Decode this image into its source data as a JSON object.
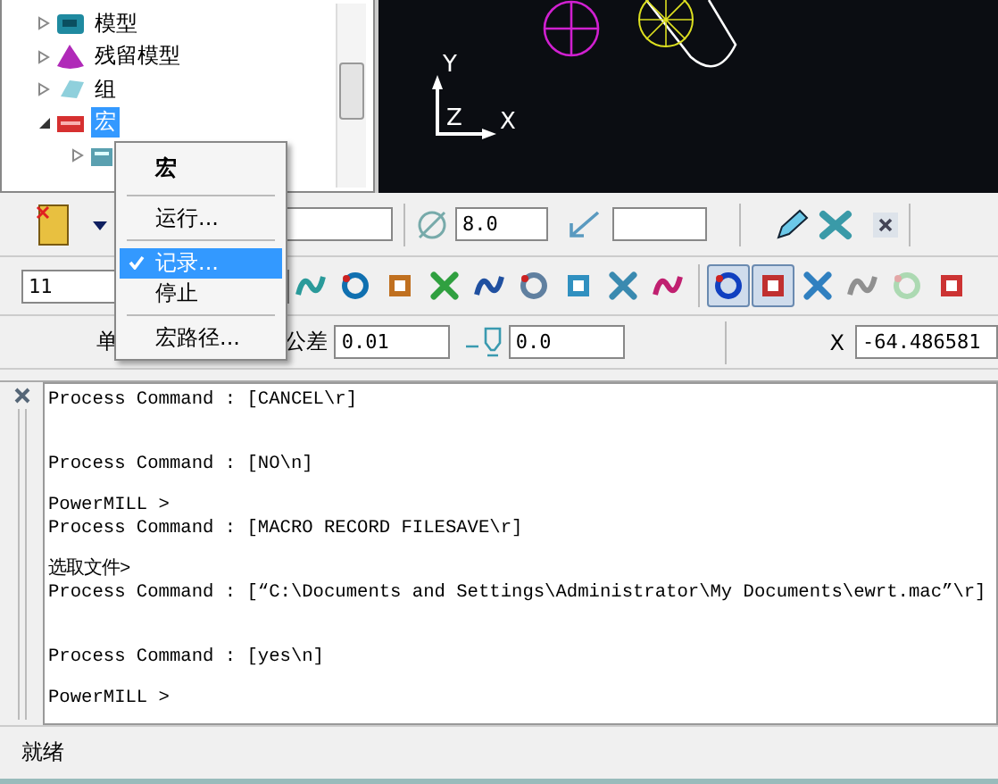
{
  "tree": {
    "items": [
      {
        "label": "模型",
        "expanded": false,
        "selected": false
      },
      {
        "label": "残留模型",
        "expanded": false,
        "selected": false
      },
      {
        "label": "组",
        "expanded": false,
        "selected": false
      },
      {
        "label": "宏",
        "expanded": true,
        "selected": true,
        "children": [
          {
            "expanded": false,
            "selected": false
          }
        ]
      }
    ]
  },
  "viewport": {
    "axis_y": "Y",
    "axis_z": "Z",
    "axis_x": "X"
  },
  "context_menu": {
    "title": "宏",
    "items": [
      {
        "label": "运行...",
        "checked": false,
        "selected": false,
        "separator_before": true
      },
      {
        "label": "记录...",
        "checked": true,
        "selected": true,
        "separator_before": true
      },
      {
        "label": "停止",
        "checked": false,
        "selected": false,
        "separator_before": false
      },
      {
        "label": "宏路径...",
        "checked": false,
        "selected": false,
        "separator_before": true
      }
    ]
  },
  "toolbar1": {
    "diameter": "8.0"
  },
  "toolbar2": {
    "combo": "11",
    "tools": [
      {
        "pressed": false,
        "disabled": false
      },
      {
        "pressed": false,
        "disabled": false
      },
      {
        "pressed": false,
        "disabled": false
      },
      {
        "pressed": false,
        "disabled": false
      },
      {
        "pressed": false,
        "disabled": false
      },
      {
        "pressed": false,
        "disabled": false
      },
      {
        "pressed": false,
        "disabled": false
      },
      {
        "pressed": false,
        "disabled": false
      },
      {
        "pressed": false,
        "disabled": false
      },
      {
        "pressed": true,
        "disabled": false
      },
      {
        "pressed": true,
        "disabled": false
      },
      {
        "pressed": false,
        "disabled": false
      },
      {
        "pressed": false,
        "disabled": false
      },
      {
        "pressed": false,
        "disabled": true
      },
      {
        "pressed": false,
        "disabled": false
      }
    ]
  },
  "toolbar3": {
    "unit_label": "单",
    "tolerance_label": "公差",
    "tolerance": "0.01",
    "thickness": "0.0",
    "x_label": "X",
    "x_value": "-64.486581"
  },
  "command_window": {
    "lines": [
      {
        "kind": "command",
        "text": "Process Command : [CANCEL\\r]"
      },
      {
        "kind": "command",
        "text": "Process Command : [NO\\n]"
      },
      {
        "kind": "prompt",
        "text": "PowerMILL >"
      },
      {
        "kind": "command",
        "text": "Process Command : [MACRO RECORD FILESAVE\\r]"
      },
      {
        "kind": "prompt",
        "text": "选取文件>"
      },
      {
        "kind": "command",
        "text": "Process Command : [“C:\\Documents and Settings\\Administrator\\My Documents\\ewrt.mac”\\r]"
      },
      {
        "kind": "command",
        "text": "Process Command : [yes\\n]"
      },
      {
        "kind": "prompt",
        "text": "PowerMILL >"
      }
    ]
  },
  "status_bar": {
    "text": "就绪"
  }
}
